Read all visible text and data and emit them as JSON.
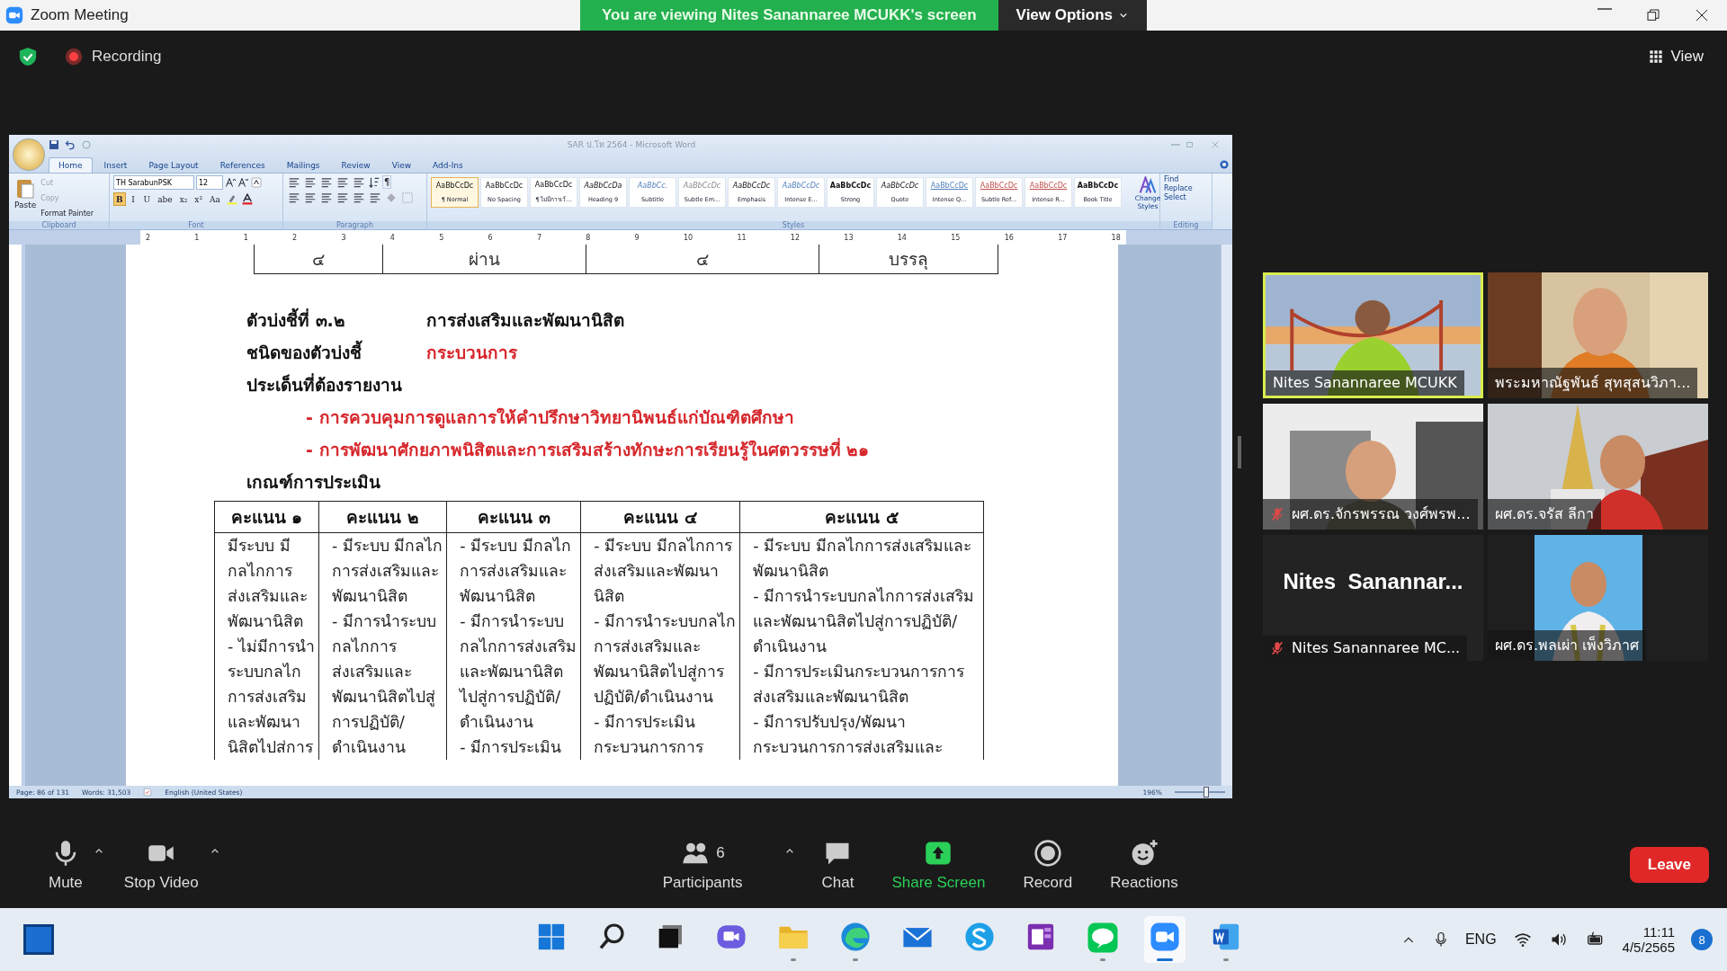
{
  "window": {
    "title": "Zoom Meeting"
  },
  "share_banner": {
    "text": "You are viewing Nites Sanannaree MCUKK's screen",
    "options": "View Options"
  },
  "recording": "Recording",
  "view_button": "View",
  "shared_screen": {
    "title": "SAR ป.โท 2564 - Microsoft Word",
    "tabs": [
      {
        "label": "Home",
        "selected": true
      },
      {
        "label": "Insert",
        "selected": false
      },
      {
        "label": "Page Layout",
        "selected": false
      },
      {
        "label": "References",
        "selected": false
      },
      {
        "label": "Mailings",
        "selected": false
      },
      {
        "label": "Review",
        "selected": false
      },
      {
        "label": "View",
        "selected": false
      },
      {
        "label": "Add-Ins",
        "selected": false
      }
    ],
    "ribbon": {
      "clipboard": {
        "label": "Clipboard",
        "paste": "Paste",
        "items": [
          {
            "label": "Cut",
            "disabled": true
          },
          {
            "label": "Copy",
            "disabled": true
          },
          {
            "label": "Format Painter",
            "disabled": false
          }
        ]
      },
      "font": {
        "label": "Font",
        "name": "TH SarabunPSK",
        "size": "12",
        "buttons": [
          {
            "label": "B",
            "selected": true
          },
          {
            "label": "I",
            "selected": false
          },
          {
            "label": "U",
            "selected": false
          },
          {
            "label": "abe",
            "selected": false
          },
          {
            "label": "x₂",
            "selected": false
          },
          {
            "label": "x²",
            "selected": false
          },
          {
            "label": "Aa",
            "selected": false
          }
        ]
      },
      "paragraph": {
        "label": "Paragraph",
        "pilcrow": "¶"
      },
      "styles": {
        "label": "Styles",
        "change": "Change Styles",
        "items": [
          {
            "preview": "AaBbCcDc",
            "name": "¶ Normal",
            "kind": "plain",
            "selected": true
          },
          {
            "preview": "AaBbCcDc",
            "name": "No Spacing",
            "kind": "plain",
            "selected": false
          },
          {
            "preview": "AaBbCcDc",
            "name": "¶ ไม่มีการเว้...",
            "kind": "plain",
            "selected": false
          },
          {
            "preview": "AaBbCcDa",
            "name": "Heading 9",
            "kind": "italic",
            "selected": false
          },
          {
            "preview": "AaBbCc.",
            "name": "Subtitle",
            "kind": "soft",
            "selected": false
          },
          {
            "preview": "AaBbCcDc",
            "name": "Subtle Em...",
            "kind": "faint",
            "selected": false
          },
          {
            "preview": "AaBbCcDc",
            "name": "Emphasis",
            "kind": "italic",
            "selected": false
          },
          {
            "preview": "AaBbCcDc",
            "name": "Intense E...",
            "kind": "soft",
            "selected": false
          },
          {
            "preview": "AaBbCcDc",
            "name": "Strong",
            "kind": "bold",
            "selected": false
          },
          {
            "preview": "AaBbCcDc",
            "name": "Quote",
            "kind": "italic",
            "selected": false
          },
          {
            "preview": "AaBbCcDc",
            "name": "Intense Q...",
            "kind": "underline",
            "selected": false
          },
          {
            "preview": "AaBbCcDc",
            "name": "Subtle Ref...",
            "kind": "reference",
            "selected": false
          },
          {
            "preview": "AaBbCcDc",
            "name": "Intense R...",
            "kind": "reference",
            "selected": false
          },
          {
            "preview": "AaBbCcDc",
            "name": "Book Title",
            "kind": "bold",
            "selected": false
          }
        ]
      },
      "editing": {
        "label": "Editing",
        "items": [
          "Find",
          "Replace",
          "Select"
        ]
      }
    },
    "ruler": [
      "2",
      "1",
      "1",
      "2",
      "3",
      "4",
      "5",
      "6",
      "7",
      "8",
      "9",
      "10",
      "11",
      "12",
      "13",
      "14",
      "15",
      "16",
      "17",
      "18"
    ],
    "document": {
      "top_row": [
        "๔",
        "ผ่าน",
        "๔",
        "บรรลุ"
      ],
      "indicator": {
        "label": "ตัวบ่งชี้ที่ ๓.๒",
        "value": "การส่งเสริมและพัฒนานิสิต",
        "accent": false
      },
      "indicator_type": {
        "label": "ชนิดของตัวบ่งชี้",
        "value": "กระบวนการ",
        "accent": true
      },
      "report_heading": "ประเด็นที่ต้องรายงาน",
      "report_items": [
        {
          "text": "- การควบคุมการดูแลการให้คำปรึกษาวิทยานิพนธ์แก่บัณฑิตศึกษา",
          "accent": true
        },
        {
          "text": "- การพัฒนาศักยภาพนิสิตและการเสริมสร้างทักษะการเรียนรู้ในศตวรรษที่ ๒๑",
          "accent": true
        }
      ],
      "criteria_heading": "เกณฑ์การประเมิน",
      "criteria": {
        "columns": [
          "คะแนน ๑",
          "คะแนน ๒",
          "คะแนน ๓",
          "คะแนน ๔",
          "คะแนน ๕"
        ],
        "cells": [
          [
            "มีระบบ มี",
            "กลไกการ",
            "ส่งเสริมและ",
            "พัฒนานิสิต",
            "- ไม่มีการนำ",
            "ระบบกลไก",
            "การส่งเสริม",
            "และพัฒนา",
            "นิสิตไปส่การ"
          ],
          [
            "- มีระบบ มีกลไก",
            "การส่งเสริมและ",
            "พัฒนานิสิต",
            "- มีการนำระบบ",
            "กลไกการ",
            "ส่งเสริมและ",
            "พัฒนานิสิตไปสู่",
            "การปฏิบัติ/",
            "ดำเนินงาน"
          ],
          [
            "- มีระบบ มีกลไก",
            "การส่งเสริมและ",
            "พัฒนานิสิต",
            "- มีการนำระบบ",
            "กลไกการส่งเสริม",
            "และพัฒนานิสิต",
            "ไปสู่การปฏิบัติ/",
            "ดำเนินงาน",
            "- มีการประเมิน"
          ],
          [
            "- มีระบบ มีกลไกการ",
            "ส่งเสริมและพัฒนา",
            "นิสิต",
            "- มีการนำระบบกลไก",
            "การส่งเสริมและ",
            "พัฒนานิสิตไปสู่การ",
            "ปฏิบัติ/ดำเนินงาน",
            "- มีการประเมิน",
            "กระบวนการการ"
          ],
          [
            "- มีระบบ มีกลไกการส่งเสริมและ",
            "พัฒนานิสิต",
            "- มีการนำระบบกลไกการส่งเสริม",
            "และพัฒนานิสิตไปสู่การปฏิบัติ/",
            "ดำเนินงาน",
            "- มีการประเมินกระบวนการการ",
            "ส่งเสริมและพัฒนานิสิต",
            "- มีการปรับปรุง/พัฒนา",
            "กระบวนการการส่งเสริมและ"
          ]
        ]
      }
    },
    "status_bar": {
      "page": "Page: 86 of 131",
      "words": "Words: 31,503",
      "language": "English (United States)",
      "zoom": "196%",
      "zoom_slider": {
        "level": 0.6
      }
    }
  },
  "participants": [
    {
      "name": "Nites Sanannaree MCUKK",
      "kind": "video",
      "speaking": true,
      "muted": false
    },
    {
      "name": "พระมหาณัฐพันธ์ สุทสุสนวิภา...",
      "kind": "video",
      "speaking": false,
      "muted": false
    },
    {
      "name": "ผศ.ดร.จักรพรรณ วงศ์พรพ...",
      "kind": "video",
      "speaking": false,
      "muted": true
    },
    {
      "name": "ผศ.ดร.จรัส  ลีกา",
      "kind": "video",
      "speaking": false,
      "muted": false
    },
    {
      "name": "Nites Sanannaree MC...",
      "kind": "name",
      "display": "Nites  Sanannar...",
      "speaking": false,
      "muted": true
    },
    {
      "name": "ผศ.ดร.พลเผ่า เพ็งวิภาศ",
      "speaking": false,
      "muted": false
    }
  ],
  "toolbar": [
    {
      "label": "Mute",
      "kind": "mic",
      "menu": true
    },
    {
      "label": "Stop Video",
      "kind": "camera",
      "menu": true
    },
    {
      "label": "Participants",
      "kind": "participants",
      "count": "6",
      "menu": true
    },
    {
      "label": "Chat",
      "kind": "chat",
      "menu": false
    },
    {
      "label": "Share Screen",
      "kind": "share",
      "menu": false
    },
    {
      "label": "Record",
      "kind": "record",
      "menu": false
    },
    {
      "label": "Reactions",
      "kind": "reactions",
      "menu": false
    }
  ],
  "leave": "Leave",
  "taskbar": {
    "apps": [
      {
        "kind": "start",
        "running": false,
        "active": false
      },
      {
        "kind": "search",
        "running": false,
        "active": false
      },
      {
        "kind": "taskview",
        "running": false,
        "active": false
      },
      {
        "kind": "chat",
        "running": false,
        "active": false
      },
      {
        "kind": "folder",
        "running": true,
        "active": false
      },
      {
        "kind": "browser",
        "running": true,
        "active": false
      },
      {
        "kind": "mail",
        "running": false,
        "active": false
      },
      {
        "kind": "circle",
        "running": false,
        "active": false
      },
      {
        "kind": "notebook",
        "running": false,
        "active": false
      },
      {
        "kind": "messenger",
        "running": true,
        "active": false
      },
      {
        "kind": "camera",
        "running": true,
        "active": true
      },
      {
        "kind": "document",
        "running": true,
        "active": false
      }
    ],
    "tray": {
      "language": "ENG",
      "time": "11:11",
      "date": "4/5/2565",
      "notifications": "8"
    }
  }
}
